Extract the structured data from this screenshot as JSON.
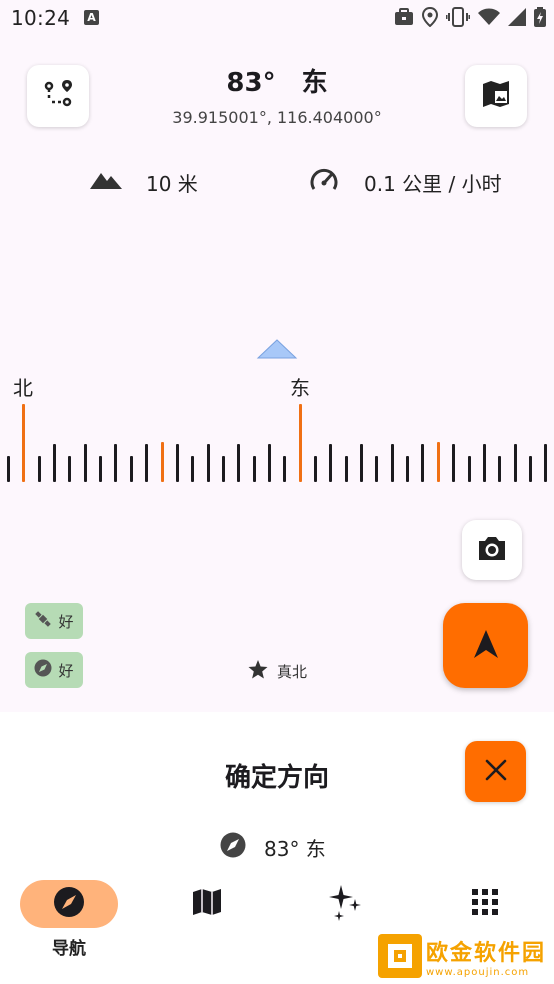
{
  "status_bar": {
    "time": "10:24",
    "left_badge": "A",
    "icons": [
      "briefcase-icon",
      "location-icon",
      "vibrate-icon",
      "wifi-icon",
      "signal-icon",
      "battery-charging-icon"
    ]
  },
  "header": {
    "bearing": "83°",
    "direction": "东",
    "coordinates": "39.915001°, 116.404000°",
    "left_button_icon": "route-icon",
    "right_button_icon": "map-icon"
  },
  "stats": {
    "altitude": "10 米",
    "altitude_icon": "mountain-icon",
    "speed": "0.1 公里 / 小时",
    "speed_icon": "speedometer-icon"
  },
  "compass": {
    "labels": [
      "北",
      "东"
    ],
    "pointer_icon": "triangle-pointer-icon"
  },
  "accuracy": {
    "gps_label": "好",
    "compass_label": "好",
    "gps_icon": "satellite-icon",
    "compass_icon": "compass-icon",
    "badge_color": "#b6dbb5"
  },
  "reference": {
    "icon": "star-icon",
    "label": "真北"
  },
  "sheet": {
    "title": "确定方向",
    "direction_readout": "83° 东",
    "close_icon": "close-icon"
  },
  "bottom_nav": {
    "items": [
      {
        "label": "导航",
        "icon": "compass-icon",
        "active": true
      },
      {
        "label": "",
        "icon": "map-icon"
      },
      {
        "label": "",
        "icon": "sparkle-icon"
      },
      {
        "label": "",
        "icon": "apps-grid-icon"
      }
    ]
  },
  "watermark": {
    "title": "欧金软件园",
    "url": "www.apoujin.com"
  },
  "colors": {
    "accent": "#ff6d00",
    "tick_major": "#f07014",
    "pointer": "#a8c8f8",
    "background": "#fdf7fd"
  }
}
